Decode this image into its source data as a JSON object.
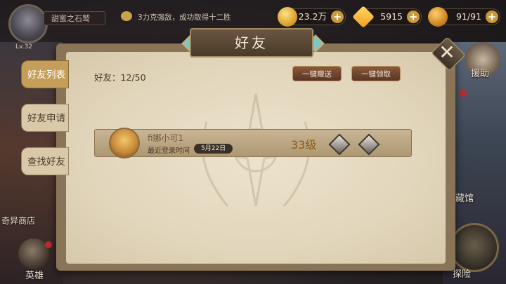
{
  "hud": {
    "level": "Lv.32",
    "player_name": "甜蜜之石鹫",
    "chat_message": "3力克强敌，成功取得十二胜",
    "gold": "23.2万",
    "gems": "5915",
    "stamina": "91/91"
  },
  "side": {
    "help": "援助",
    "collection": "藏馆",
    "explore": "探险",
    "shop": "奇异商店",
    "hero": "英雄"
  },
  "panel": {
    "title": "好友",
    "close": "✕",
    "tabs": [
      "好友列表",
      "好友申请",
      "查找好友"
    ],
    "friend_count": "好友：12/50",
    "send_all": "一键赠送",
    "claim_all": "一键领取"
  },
  "friend": {
    "name": "fi娜小可1",
    "last_login_label": "最近登录时间",
    "last_login_date": "5月22日",
    "level": "33级"
  },
  "colors": {
    "accent": "#c59f5a",
    "parchment": "#e6dbc2",
    "button": "#6a4028"
  }
}
